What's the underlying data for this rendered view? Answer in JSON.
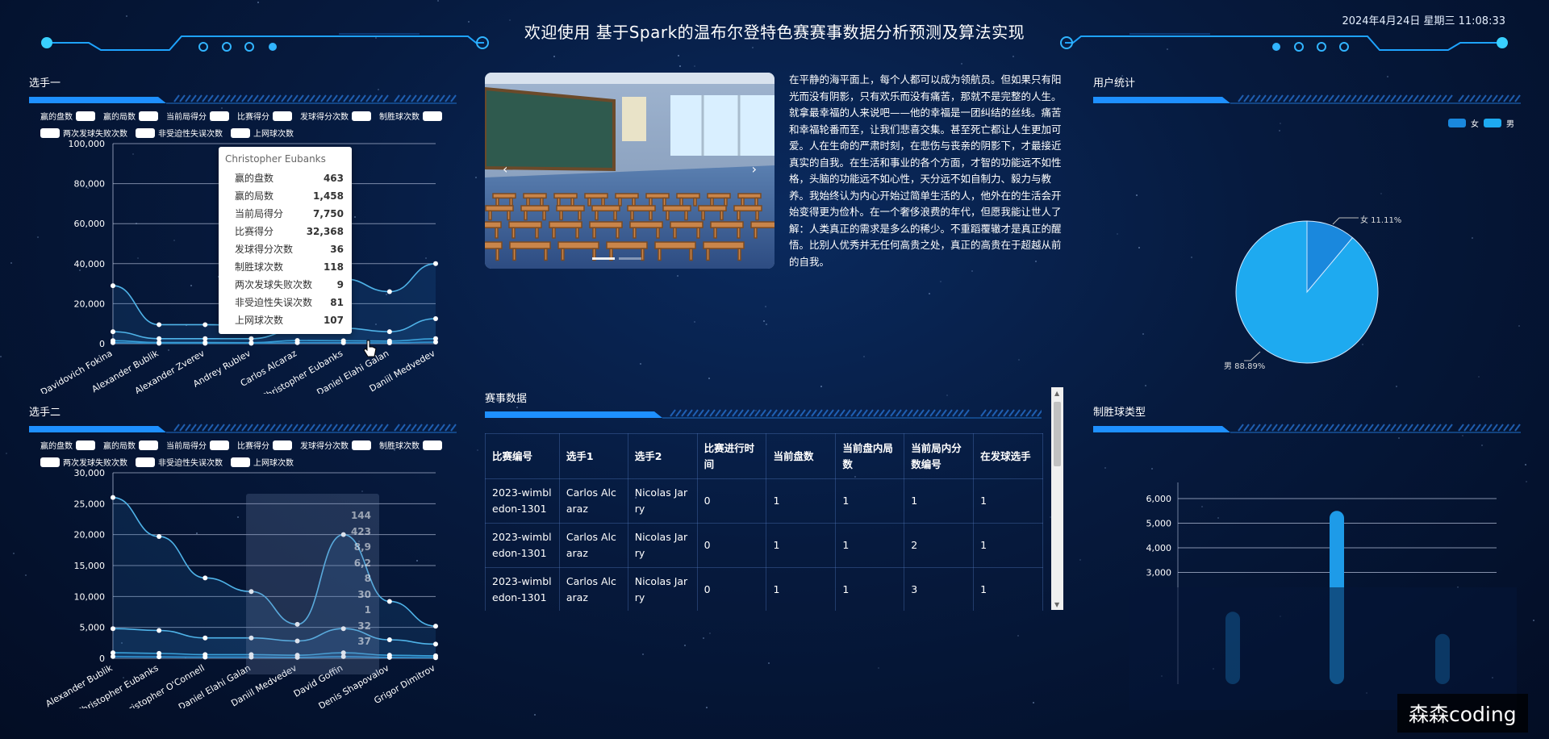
{
  "header": {
    "title": "欢迎使用 基于Spark的温布尔登特色赛赛事数据分析预测及算法实现",
    "datetime": "2024年4月24日 星期三 11:08:33"
  },
  "legend_items": [
    "赢的盘数",
    "赢的局数",
    "当前局得分",
    "比赛得分",
    "发球得分次数",
    "制胜球次数",
    "两次发球失败次数",
    "非受迫性失误次数",
    "上网球次数"
  ],
  "player1": {
    "title": "选手一",
    "tooltip": {
      "title": "Christopher Eubanks",
      "rows": [
        {
          "label": "赢的盘数",
          "value": "463"
        },
        {
          "label": "赢的局数",
          "value": "1,458"
        },
        {
          "label": "当前局得分",
          "value": "7,750"
        },
        {
          "label": "比赛得分",
          "value": "32,368"
        },
        {
          "label": "发球得分次数",
          "value": "36"
        },
        {
          "label": "制胜球次数",
          "value": "118"
        },
        {
          "label": "两次发球失败次数",
          "value": "9"
        },
        {
          "label": "非受迫性失误次数",
          "value": "81"
        },
        {
          "label": "上网球次数",
          "value": "107"
        }
      ]
    }
  },
  "player2": {
    "title": "选手二",
    "tooltip": {
      "rows": [
        {
          "value": "144"
        },
        {
          "value": "423"
        },
        {
          "value": "8,9"
        },
        {
          "value": "6,2"
        },
        {
          "value": "8"
        },
        {
          "value": "30"
        },
        {
          "value": "1"
        },
        {
          "value": "32"
        },
        {
          "value": "37"
        }
      ]
    }
  },
  "carousel": {
    "prev": "‹",
    "next": "›"
  },
  "article": {
    "text": "在平静的海平面上，每个人都可以成为领航员。但如果只有阳光而没有阴影，只有欢乐而没有痛苦，那就不是完整的人生。就拿最幸福的人来说吧——他的幸福是一团纠结的丝线。痛苦和幸福轮番而至，让我们悲喜交集。甚至死亡都让人生更加可爱。人在生命的严肃时刻，在悲伤与丧亲的阴影下，才最接近真实的自我。在生活和事业的各个方面，才智的功能远不如性格，头脑的功能远不如心性，天分远不如自制力、毅力与教养。我始终认为内心开始过简单生活的人，他外在的生活会开始变得更为俭朴。在一个奢侈浪费的年代，但愿我能让世人了解：人类真正的需求是多么的稀少。不重蹈覆辙才是真正的醒悟。比别人优秀并无任何高贵之处，真正的高贵在于超越从前的自我。"
  },
  "users": {
    "title": "用户统计",
    "legend": [
      "女",
      "男"
    ],
    "labels": [
      "女 11.11%",
      "男 88.89%"
    ]
  },
  "matches": {
    "title": "赛事数据",
    "columns": [
      "比赛编号",
      "选手1",
      "选手2",
      "比赛进行时间",
      "当前盘数",
      "当前盘内局数",
      "当前局内分数编号",
      "在发球选手"
    ],
    "rows": [
      [
        "2023-wimbledon-1301",
        "Carlos Alcaraz",
        "Nicolas Jarry",
        "0",
        "1",
        "1",
        "1",
        "1"
      ],
      [
        "2023-wimbledon-1301",
        "Carlos Alcaraz",
        "Nicolas Jarry",
        "0",
        "1",
        "1",
        "2",
        "1"
      ],
      [
        "2023-wimbledon-1301",
        "Carlos Alcaraz",
        "Nicolas Jarry",
        "0",
        "1",
        "1",
        "3",
        "1"
      ]
    ]
  },
  "winner_type": {
    "title": "制胜球类型"
  },
  "watermark": "森森coding",
  "colors": {
    "accent": "#1e90ff",
    "line": "#4fb3e8",
    "pie_main": "#1eaaf0",
    "pie_small": "#1a88dd"
  },
  "icons": {
    "cursor": "hand-cursor-icon"
  },
  "chart_data": [
    {
      "type": "line",
      "categories": [
        "Alejandro Davidovich Fokina",
        "Alexander Bublik",
        "Alexander Zverev",
        "Andrey Rublev",
        "Carlos Alcaraz",
        "Christopher Eubanks",
        "Daniel Elahi Galan",
        "Daniil Medvedev"
      ],
      "category_labels": [
        "Davidovich Fokina",
        "Alexander Bublik",
        "Alexander Zverev",
        "Andrey Rublev",
        "Carlos Alcaraz",
        "Christopher Eubanks",
        "Daniel Elahi Galan",
        "Daniil Medvedev"
      ],
      "ylim": [
        0,
        100000
      ],
      "yticks": [
        "0",
        "20,000",
        "40,000",
        "60,000",
        "80,000",
        "100,000"
      ],
      "series": [
        {
          "name": "比赛得分",
          "values": [
            29000,
            9500,
            9500,
            9000,
            32000,
            32368,
            26000,
            40000
          ]
        },
        {
          "name": "当前局得分",
          "values": [
            6000,
            2500,
            2500,
            2500,
            7000,
            7750,
            6000,
            12500
          ]
        },
        {
          "name": "赢的局数",
          "values": [
            1500,
            600,
            600,
            500,
            1600,
            1458,
            1300,
            2500
          ]
        },
        {
          "name": "赢的盘数",
          "values": [
            500,
            200,
            200,
            200,
            500,
            463,
            400,
            800
          ]
        }
      ]
    },
    {
      "type": "line",
      "categories": [
        "Alexander Bublik",
        "Christopher Eubanks",
        "Christopher O'Connell",
        "Daniel Elahi Galan",
        "Daniil Medvedev",
        "David Goffin",
        "Denis Shapovalov",
        "Grigor Dimitrov"
      ],
      "category_labels": [
        "Alexander Bublik",
        "Christopher Eubanks",
        "Christopher O'Connell",
        "Daniel Elahi Galan",
        "Daniil Medvedev",
        "David Goffin",
        "Denis Shapovalov",
        "Grigor Dimitrov"
      ],
      "ylim": [
        0,
        30000
      ],
      "yticks": [
        "0",
        "5,000",
        "10,000",
        "15,000",
        "20,000",
        "25,000",
        "30,000"
      ],
      "series": [
        {
          "name": "比赛得分",
          "values": [
            26000,
            19700,
            13000,
            10800,
            5500,
            20000,
            9200,
            5200
          ]
        },
        {
          "name": "当前局得分",
          "values": [
            4800,
            4500,
            3300,
            3300,
            2800,
            4800,
            3000,
            2300
          ]
        },
        {
          "name": "赢的局数",
          "values": [
            900,
            800,
            600,
            600,
            500,
            900,
            500,
            400
          ]
        },
        {
          "name": "赢的盘数",
          "values": [
            300,
            250,
            200,
            200,
            150,
            280,
            150,
            100
          ]
        }
      ]
    },
    {
      "type": "pie",
      "categories": [
        "女",
        "男"
      ],
      "values": [
        11.11,
        88.89
      ]
    },
    {
      "type": "bar",
      "yticks": [
        "3,000",
        "4,000",
        "5,000",
        "6,000"
      ],
      "ylim": [
        2000,
        6000
      ],
      "values": [
        1400,
        5500,
        500
      ]
    }
  ]
}
